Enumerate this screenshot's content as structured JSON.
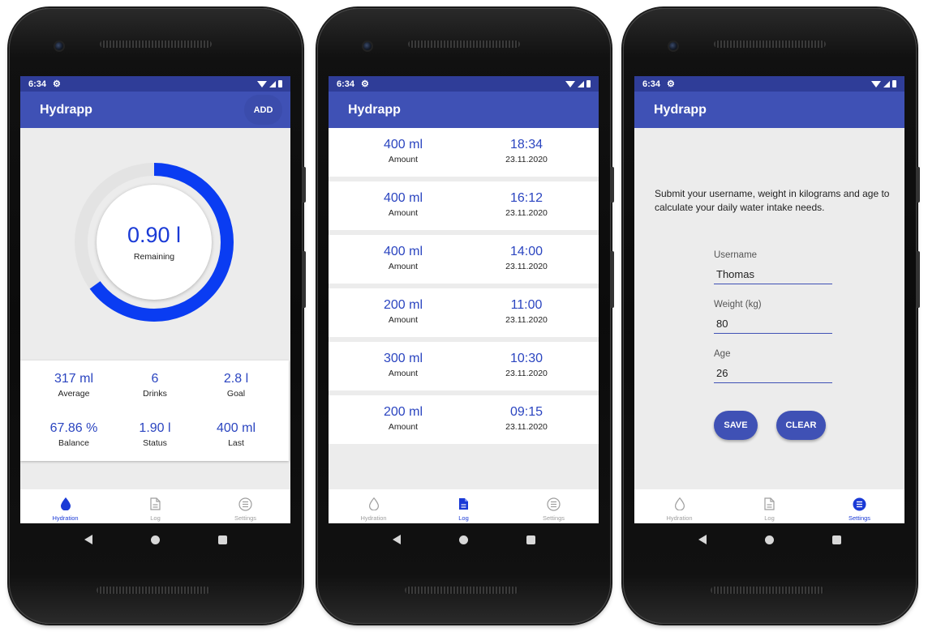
{
  "status": {
    "time": "6:34"
  },
  "app": {
    "title": "Hydrapp",
    "add_label": "ADD"
  },
  "nav": {
    "hydration": "Hydration",
    "log": "Log",
    "settings": "Settings"
  },
  "hydration": {
    "remaining_value": "0.90 l",
    "remaining_label": "Remaining",
    "progress_fraction": 0.65,
    "colors": {
      "progress": "#0a3cf2",
      "track": "#e3e3e3"
    },
    "stats": [
      {
        "value": "317 ml",
        "label": "Average"
      },
      {
        "value": "6",
        "label": "Drinks"
      },
      {
        "value": "2.8 l",
        "label": "Goal"
      },
      {
        "value": "67.86 %",
        "label": "Balance"
      },
      {
        "value": "1.90 l",
        "label": "Status"
      },
      {
        "value": "400 ml",
        "label": "Last"
      }
    ]
  },
  "log": {
    "entries": [
      {
        "amount": "400 ml",
        "amount_label": "Amount",
        "time": "18:34",
        "date": "23.11.2020"
      },
      {
        "amount": "400 ml",
        "amount_label": "Amount",
        "time": "16:12",
        "date": "23.11.2020"
      },
      {
        "amount": "400 ml",
        "amount_label": "Amount",
        "time": "14:00",
        "date": "23.11.2020"
      },
      {
        "amount": "200 ml",
        "amount_label": "Amount",
        "time": "11:00",
        "date": "23.11.2020"
      },
      {
        "amount": "300 ml",
        "amount_label": "Amount",
        "time": "10:30",
        "date": "23.11.2020"
      },
      {
        "amount": "200 ml",
        "amount_label": "Amount",
        "time": "09:15",
        "date": "23.11.2020"
      }
    ]
  },
  "settings": {
    "intro": "Submit your username, weight in kilograms and age to calculate your daily water intake needs.",
    "username_label": "Username",
    "username_value": "Thomas",
    "weight_label": "Weight (kg)",
    "weight_value": "80",
    "age_label": "Age",
    "age_value": "26",
    "save_label": "SAVE",
    "clear_label": "CLEAR"
  }
}
